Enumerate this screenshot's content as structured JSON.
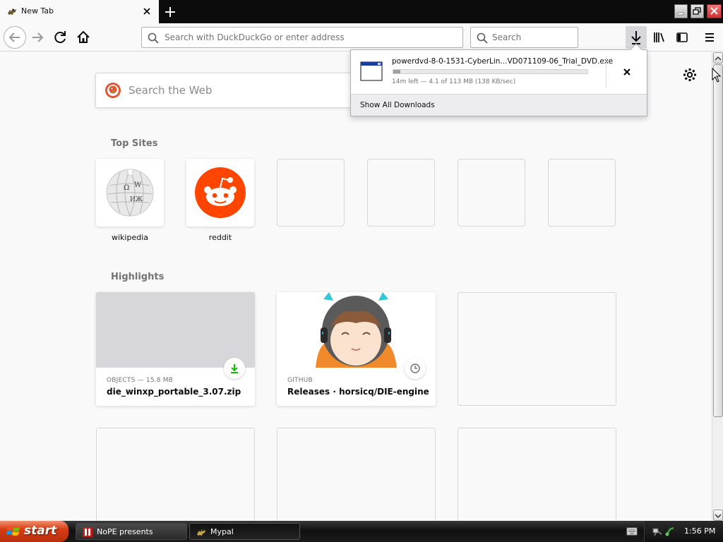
{
  "browser": {
    "tab": {
      "title": "New Tab"
    },
    "urlbar": {
      "placeholder": "Search with DuckDuckGo or enter address"
    },
    "searchbar": {
      "placeholder": "Search"
    }
  },
  "newtab": {
    "web_search": {
      "placeholder": "Search the Web"
    },
    "top_sites": {
      "title": "Top Sites",
      "sites": [
        {
          "label": "wikipedia",
          "icon": "wikipedia-globe-icon"
        },
        {
          "label": "reddit",
          "icon": "reddit-alien-icon"
        },
        {
          "label": ""
        },
        {
          "label": ""
        },
        {
          "label": ""
        },
        {
          "label": ""
        }
      ]
    },
    "highlights": {
      "title": "Highlights",
      "cards": [
        {
          "context": "OBJECTS — 15.8 MB",
          "title": "die_winxp_portable_3.07.zip",
          "badge": "download-icon"
        },
        {
          "context": "GITHUB",
          "title": "Releases · horsicq/DIE-engine",
          "badge": "clock-icon"
        }
      ]
    }
  },
  "downloads_panel": {
    "item": {
      "filename": "powerdvd-8-0-1531-CyberLin...VD071109-06_Trial_DVD.exe",
      "status": "14m left — 4.1 of 113 MB (138 KB/sec)",
      "progress": 0.036
    },
    "show_all_label": "Show All Downloads"
  },
  "taskbar": {
    "start_label": "start",
    "tasks": [
      {
        "label": "NoPE presents"
      },
      {
        "label": "Mypal"
      }
    ],
    "clock": "1:56 PM"
  },
  "colors": {
    "accent_green": "#12bc00",
    "reddit_orange": "#ff4500",
    "ddg_orange": "#de5833",
    "xp_start": "#d63c14"
  }
}
